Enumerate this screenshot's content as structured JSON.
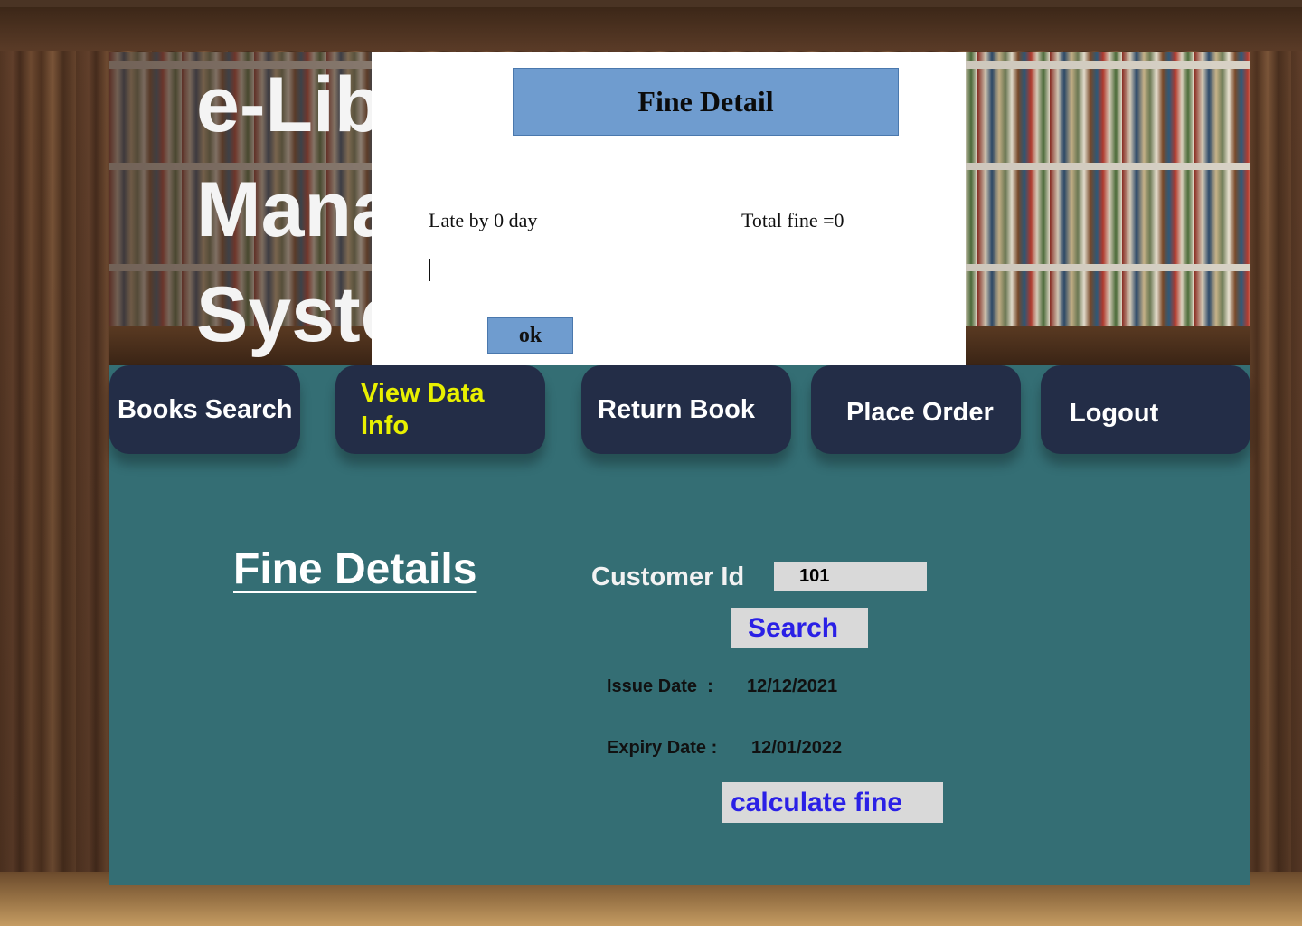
{
  "app": {
    "title": "e-Library Management System"
  },
  "nav": {
    "books_search": "Books Search",
    "view_data_info": "View Data Info",
    "return_book": "Return Book",
    "place_order": "Place Order",
    "logout": "Logout"
  },
  "main": {
    "heading": "Fine Details",
    "customer_id_label": "Customer Id",
    "customer_id_value": "101",
    "search_button": "Search",
    "issue_date_label": "Issue Date  :",
    "issue_date_value": "12/12/2021",
    "expiry_date_label": "Expiry Date :",
    "expiry_date_value": "12/01/2022",
    "calculate_button": "calculate fine"
  },
  "dialog": {
    "title": "Fine Detail",
    "late_text": "Late by 0 day",
    "total_text": "Total fine =0",
    "ok_button": "ok"
  },
  "colors": {
    "panel": "#346e74",
    "nav_button": "#232d47",
    "nav_active_text": "#e8f000",
    "action_text": "#2a20e6",
    "dialog_accent": "#6f9ccf"
  }
}
